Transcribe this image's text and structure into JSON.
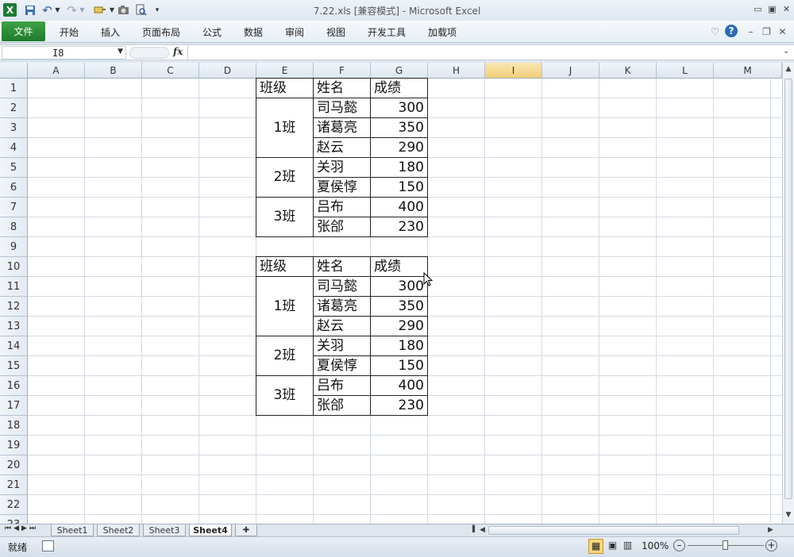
{
  "window": {
    "title": "7.22.xls  [兼容模式]  -  Microsoft Excel",
    "controls": {
      "minimize": "▭",
      "restore": "▣",
      "close": "✕"
    }
  },
  "quick_access": {
    "undo": "↶",
    "redo": "↷",
    "more": "▾"
  },
  "ribbon": {
    "file_tab": "文件",
    "tabs": [
      "开始",
      "插入",
      "页面布局",
      "公式",
      "数据",
      "审阅",
      "视图",
      "开发工具",
      "加载项"
    ]
  },
  "formula_bar": {
    "name_box": "I8",
    "fx_label": "fx",
    "formula": ""
  },
  "grid": {
    "columns": [
      "A",
      "B",
      "C",
      "D",
      "E",
      "F",
      "G",
      "H",
      "I",
      "J",
      "K",
      "L",
      "M"
    ],
    "selected_column": "I",
    "rows": [
      "1",
      "2",
      "3",
      "4",
      "5",
      "6",
      "7",
      "8",
      "9",
      "10",
      "11",
      "12",
      "13",
      "14",
      "15",
      "16",
      "17",
      "18",
      "19",
      "20",
      "21",
      "22",
      "23"
    ],
    "table1": {
      "headers": [
        "班级",
        "姓名",
        "成绩"
      ],
      "groups": [
        {
          "class": "1班",
          "rows": [
            {
              "name": "司马懿",
              "score": "300"
            },
            {
              "name": "诸葛亮",
              "score": "350"
            },
            {
              "name": "赵云",
              "score": "290"
            }
          ]
        },
        {
          "class": "2班",
          "rows": [
            {
              "name": "关羽",
              "score": "180"
            },
            {
              "name": "夏侯惇",
              "score": "150"
            }
          ]
        },
        {
          "class": "3班",
          "rows": [
            {
              "name": "吕布",
              "score": "400"
            },
            {
              "name": "张郃",
              "score": "230"
            }
          ]
        }
      ]
    },
    "table2": {
      "headers": [
        "班级",
        "姓名",
        "成绩"
      ],
      "groups": [
        {
          "class": "1班",
          "rows": [
            {
              "name": "司马懿",
              "score": "300"
            },
            {
              "name": "诸葛亮",
              "score": "350"
            },
            {
              "name": "赵云",
              "score": "290"
            }
          ]
        },
        {
          "class": "2班",
          "rows": [
            {
              "name": "关羽",
              "score": "180"
            },
            {
              "name": "夏侯惇",
              "score": "150"
            }
          ]
        },
        {
          "class": "3班",
          "rows": [
            {
              "name": "吕布",
              "score": "400"
            },
            {
              "name": "张郃",
              "score": "230"
            }
          ]
        }
      ]
    }
  },
  "sheet_tabs": {
    "tabs": [
      "Sheet1",
      "Sheet2",
      "Sheet3",
      "Sheet4"
    ],
    "active": "Sheet4"
  },
  "status_bar": {
    "status": "就绪",
    "zoom": "100%"
  },
  "colors": {
    "file_tab": "#2a8d37",
    "header_bg": "#e3eaf2",
    "selected_header": "#f1ce77",
    "grid_line": "#d4dbe3"
  }
}
